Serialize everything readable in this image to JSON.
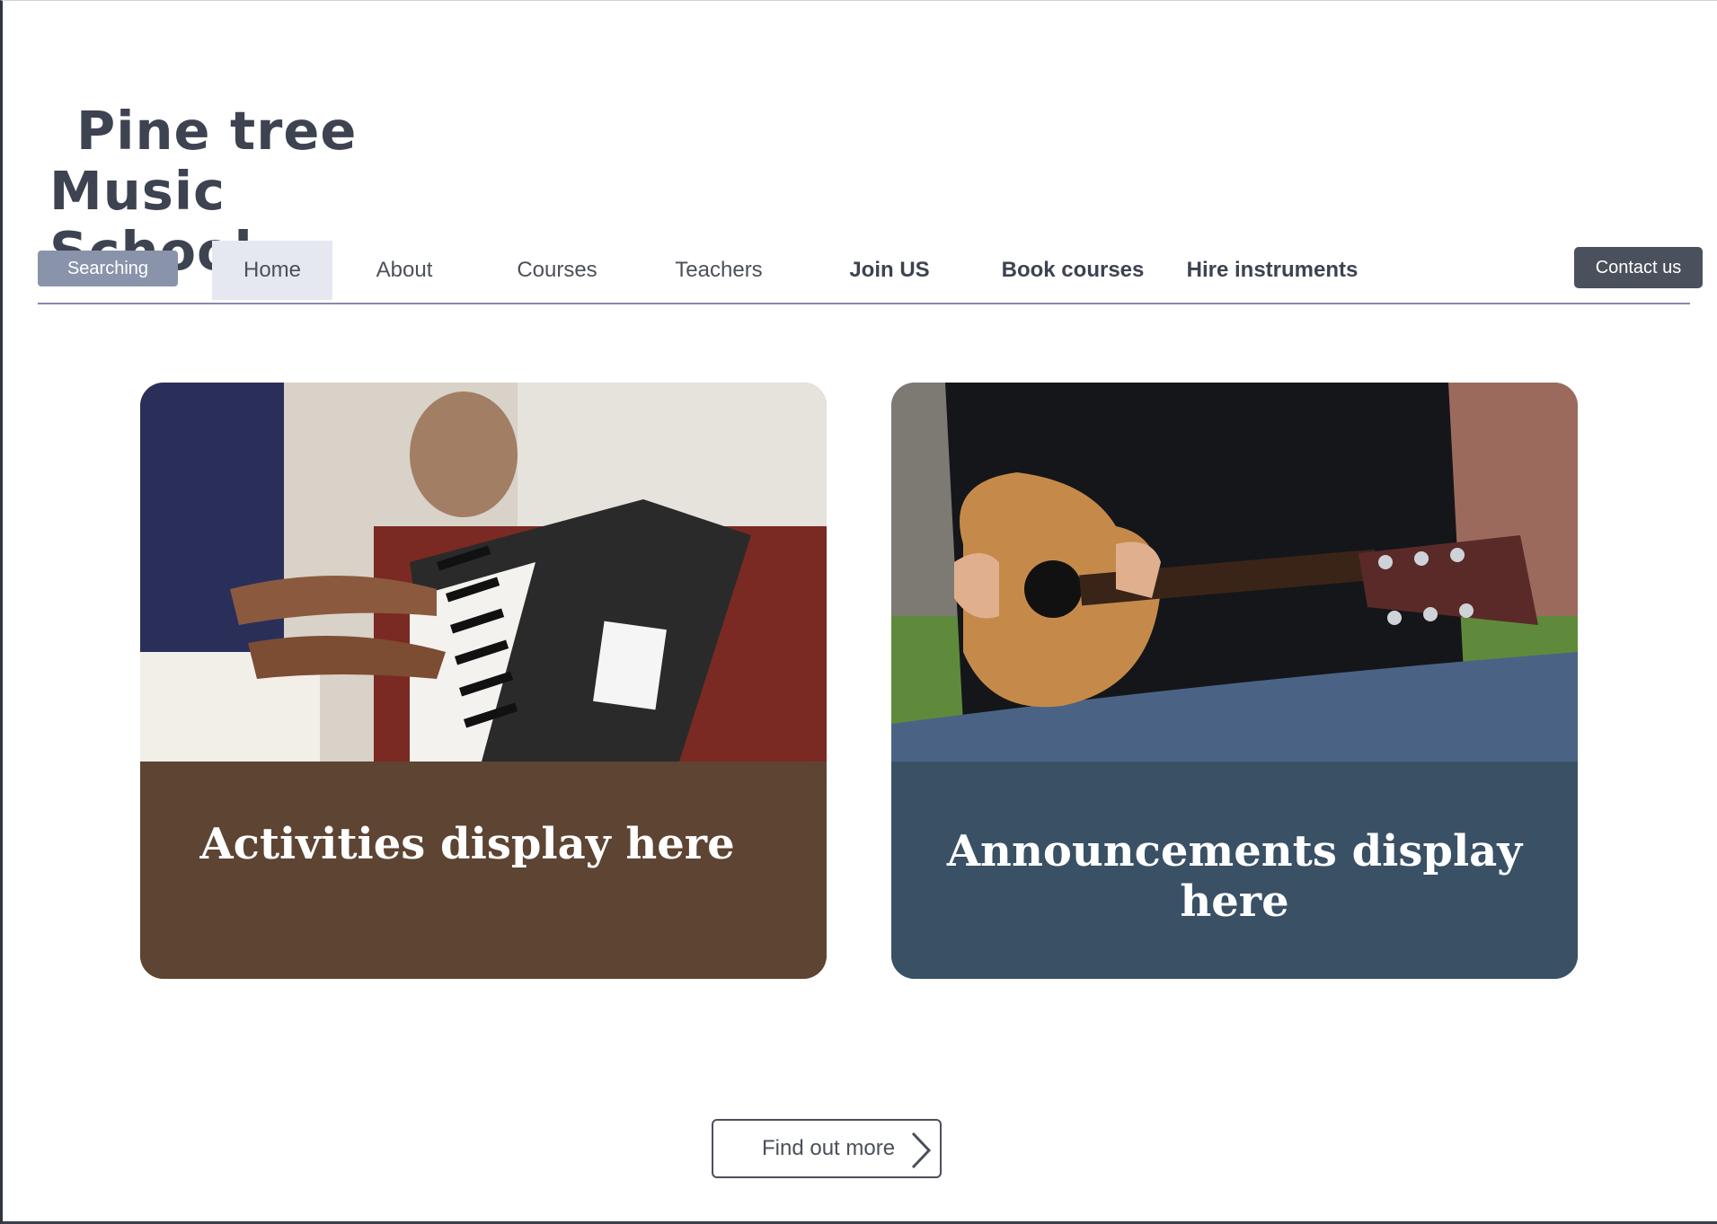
{
  "brand": {
    "line1": "Pine tree",
    "line2": "Music School"
  },
  "nav": {
    "search_label": "Searching",
    "items": [
      {
        "label": "Home",
        "active": true
      },
      {
        "label": "About"
      },
      {
        "label": "Courses"
      },
      {
        "label": "Teachers"
      },
      {
        "label": "Join US"
      },
      {
        "label": "Book courses"
      },
      {
        "label": "Hire instruments"
      }
    ],
    "contact_label": "Contact us"
  },
  "cards": [
    {
      "caption": "Activities display here",
      "image": "piano-keyboard-photo",
      "color": "#5d4433"
    },
    {
      "caption": "Announcements display here",
      "image": "acoustic-guitar-photo",
      "color": "#3a5065"
    }
  ],
  "cta": {
    "label": "Find out more",
    "icon": "chevron-right-icon"
  },
  "colors": {
    "nav_accent": "#8c86b3",
    "contact_bg": "#4a505c",
    "search_bg": "#8994ab",
    "active_tab_bg": "#e5e8f1"
  }
}
